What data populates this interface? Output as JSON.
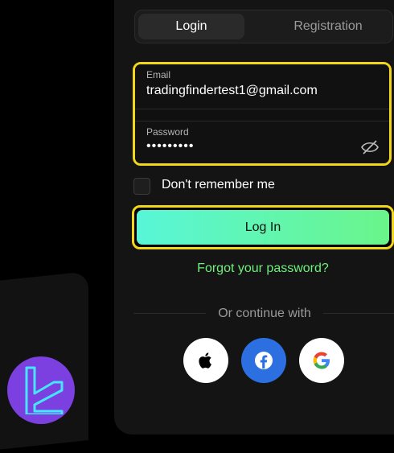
{
  "tabs": {
    "login": "Login",
    "registration": "Registration"
  },
  "form": {
    "email_label": "Email",
    "email_value": "tradingfindertest1@gmail.com",
    "password_label": "Password",
    "password_value": "•••••••••"
  },
  "remember_label": "Don't remember me",
  "login_button": "Log In",
  "forgot_link": "Forgot your password?",
  "continue_text": "Or continue with",
  "social_icons": [
    "apple-icon",
    "facebook-icon",
    "google-icon"
  ],
  "colors": {
    "highlight": "#f3d51a",
    "accent_green": "#6ff07b",
    "button_gradient_start": "#58f6d8",
    "button_gradient_end": "#6af58a",
    "facebook_blue": "#2b6fe0",
    "logo_purple": "#7c3fe0"
  }
}
